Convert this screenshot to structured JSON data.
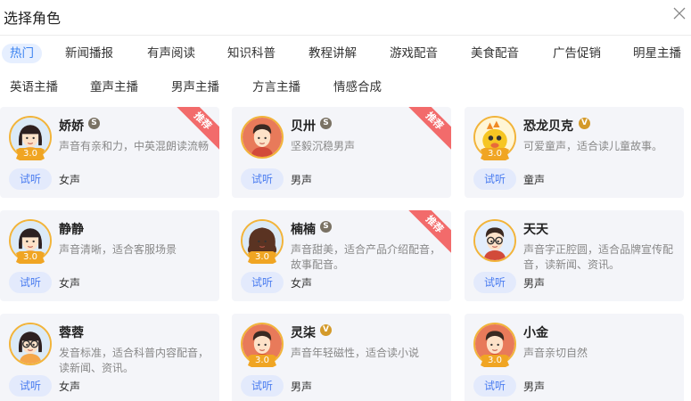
{
  "dialog": {
    "title": "选择角色"
  },
  "tags": [
    "热门",
    "新闻播报",
    "有声阅读",
    "知识科普",
    "教程讲解",
    "游戏配音",
    "美食配音",
    "广告促销",
    "明星主播",
    "英语主播",
    "童声主播",
    "男声主播",
    "方言主播",
    "情感合成"
  ],
  "tags_active": "热门",
  "listen_label": "试听",
  "recommend_label": "推荐",
  "voices": [
    {
      "name": "娇娇",
      "badge": "S",
      "desc": "声音有亲和力，中英混朗读流畅",
      "gender": "女声",
      "level": "3.0",
      "recommended": true,
      "avatar": "female-avatar-icon"
    },
    {
      "name": "贝卅",
      "badge": "S",
      "desc": "坚毅沉稳男声",
      "gender": "男声",
      "recommended": true,
      "avatar": "male-avatar-icon"
    },
    {
      "name": "恐龙贝克",
      "badge": "V",
      "desc": "可爱童声，适合读儿童故事。",
      "gender": "童声",
      "level": "3.0",
      "recommended": false,
      "avatar": "dinosaur-avatar-icon"
    },
    {
      "name": "静静",
      "desc": "声音清晰，适合客服场景",
      "gender": "女声",
      "level": "3.0",
      "recommended": false,
      "avatar": "female-avatar-icon"
    },
    {
      "name": "楠楠",
      "badge": "S",
      "desc": "声音甜美，适合产品介绍配音，故事配音。",
      "gender": "女声",
      "level": "3.0",
      "recommended": true,
      "avatar": "female-curly-avatar-icon"
    },
    {
      "name": "天天",
      "desc": "声音字正腔圆，适合品牌宣传配音，读新闻、资讯。",
      "gender": "男声",
      "recommended": false,
      "avatar": "male-glasses-avatar-icon"
    },
    {
      "name": "蓉蓉",
      "desc": "发音标准，适合科普内容配音，读新闻、资讯。",
      "gender": "女声",
      "recommended": false,
      "avatar": "female-glasses-avatar-icon"
    },
    {
      "name": "灵柒",
      "badge": "V",
      "desc": "声音年轻磁性，适合读小说",
      "gender": "男声",
      "level": "3.0",
      "recommended": false,
      "avatar": "male-avatar-icon"
    },
    {
      "name": "小金",
      "desc": "声音亲切自然",
      "gender": "男声",
      "level": "3.0",
      "recommended": false,
      "avatar": "male-avatar-icon"
    }
  ],
  "colors": {
    "accent": "#3b83f0",
    "ribbon": "#f26b6b",
    "card_bg": "#f4f5f9",
    "level_gold": "#f2b43a"
  }
}
